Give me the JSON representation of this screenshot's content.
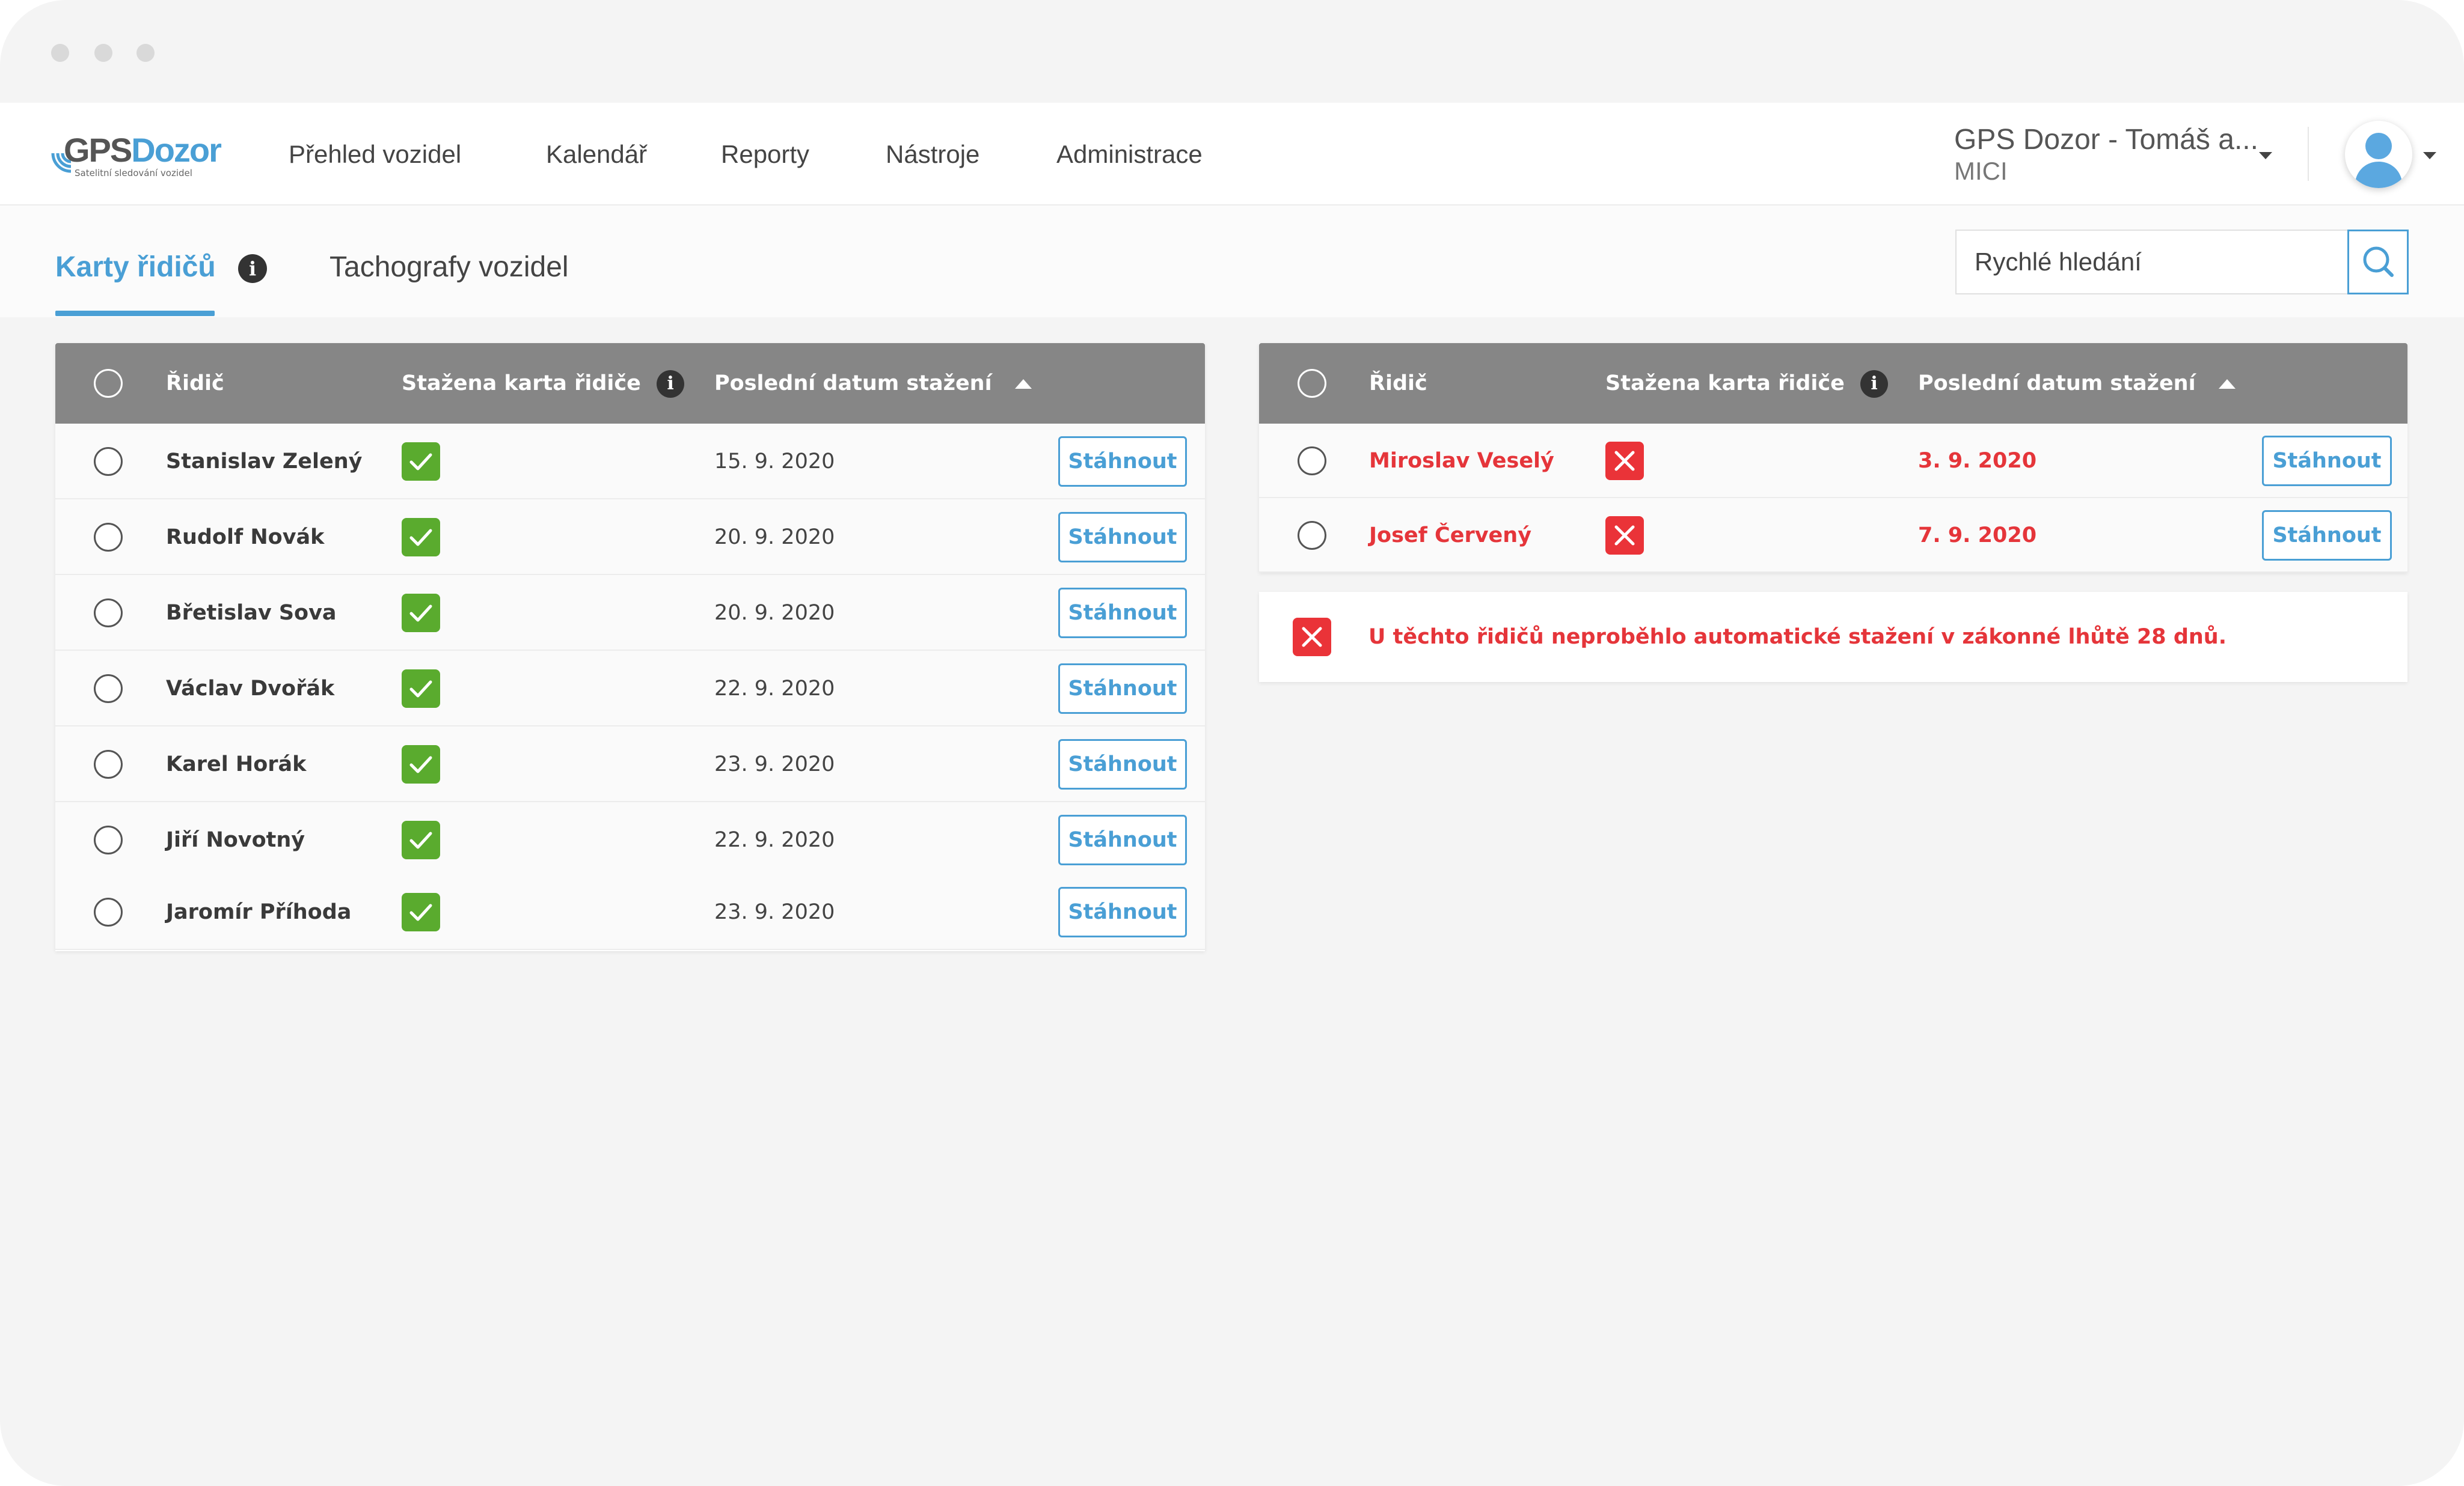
{
  "logo": {
    "brand_gps": "GPS",
    "brand_dozor": "Dozor",
    "tagline": "Satelitní sledování vozidel"
  },
  "nav": {
    "items": [
      "Přehled vozidel",
      "Kalendář",
      "Reporty",
      "Nástroje",
      "Administrace"
    ],
    "account_name": "GPS Dozor - Tomáš a...",
    "account_sub": "MICI"
  },
  "tabs": {
    "active": "Karty řidičů",
    "second": "Tachografy vozidel",
    "info": "i"
  },
  "search": {
    "placeholder": "Rychlé hledání"
  },
  "table_headers": {
    "driver": "Řidič",
    "card_downloaded": "Stažena karta řidiče",
    "last_download": "Poslední datum stažení",
    "info": "i"
  },
  "left_table": {
    "rows": [
      {
        "name": "Stanislav Zelený",
        "downloaded": true,
        "date": "15. 9. 2020",
        "action": "Stáhnout"
      },
      {
        "name": "Rudolf Novák",
        "downloaded": true,
        "date": "20. 9. 2020",
        "action": "Stáhnout"
      },
      {
        "name": "Břetislav Sova",
        "downloaded": true,
        "date": "20. 9. 2020",
        "action": "Stáhnout"
      },
      {
        "name": "Václav Dvořák",
        "downloaded": true,
        "date": "22. 9. 2020",
        "action": "Stáhnout"
      },
      {
        "name": "Karel Horák",
        "downloaded": true,
        "date": "23. 9. 2020",
        "action": "Stáhnout"
      },
      {
        "name": "Jiří Novotný",
        "downloaded": true,
        "date": "22. 9. 2020",
        "action": "Stáhnout"
      },
      {
        "name": "Jaromír Příhoda",
        "downloaded": true,
        "date": "23. 9. 2020",
        "action": "Stáhnout"
      }
    ]
  },
  "right_table": {
    "rows": [
      {
        "name": "Miroslav Veselý",
        "downloaded": false,
        "date": "3. 9. 2020",
        "action": "Stáhnout"
      },
      {
        "name": "Josef Červený",
        "downloaded": false,
        "date": "7. 9. 2020",
        "action": "Stáhnout"
      }
    ]
  },
  "warning": {
    "text": "U těchto řidičů neproběhlo automatické stažení v zákonné lhůtě 28 dnů."
  },
  "colors": {
    "accent": "#4a9fd5",
    "header_gray": "#868686",
    "ok_green": "#5aab2e",
    "error_red": "#e5353a"
  },
  "icons": {
    "window_dots": "window-dots",
    "search": "search-icon",
    "info": "info-icon",
    "sort": "sort-up-icon",
    "checked": "checkmark-icon",
    "failed": "x-mark-icon",
    "user": "user-avatar-icon",
    "dropdown": "caret-down-icon"
  }
}
